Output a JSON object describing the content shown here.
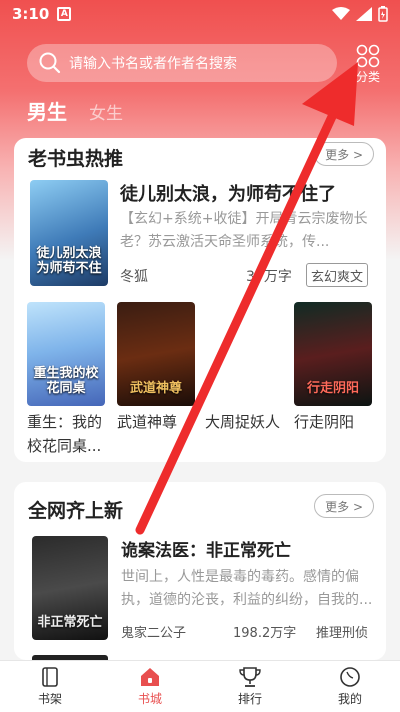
{
  "status": {
    "time": "3:10",
    "notif_glyph": "A"
  },
  "search": {
    "placeholder": "请输入书名或者作者名搜索"
  },
  "category": {
    "label": "分类"
  },
  "tabs": {
    "male": "男生",
    "female": "女生"
  },
  "section1": {
    "title": "老书虫热推",
    "more": "更多 >",
    "featured": {
      "title": "徒儿别太浪，为师苟不住了",
      "description": "【玄幻+系统+收徒】开局青云宗废物长老？苏云激活天命圣师系统，传...",
      "author": "冬狐",
      "words": "37万字",
      "tag": "玄幻爽文",
      "cover_text": "徒儿别太浪为师苟不住"
    },
    "grid": [
      {
        "title": "重生：我的校花同桌...",
        "cover_text": "重生我的校花同桌"
      },
      {
        "title": "武道神尊",
        "cover_text": "武道神尊"
      },
      {
        "title": "大周捉妖人",
        "cover_text": ""
      },
      {
        "title": "行走阴阳",
        "cover_text": "行走阴阳"
      }
    ]
  },
  "section2": {
    "title": "全网齐上新",
    "more": "更多 >",
    "book": {
      "title": "诡案法医：非正常死亡",
      "description": "世间上，人性是最毒的毒药。感情的偏执，道德的沦丧，利益的纠纷，自我的...",
      "author": "鬼家二公子",
      "words": "198.2万字",
      "tag": "推理刑侦",
      "cover_text": "非正常死亡"
    }
  },
  "bottom_nav": [
    {
      "label": "书架",
      "icon": "bookshelf-icon"
    },
    {
      "label": "书城",
      "icon": "store-icon"
    },
    {
      "label": "排行",
      "icon": "trophy-icon"
    },
    {
      "label": "我的",
      "icon": "profile-icon"
    }
  ],
  "colors": {
    "accent": "#e84f4f",
    "arrow": "#ee2c2c"
  }
}
